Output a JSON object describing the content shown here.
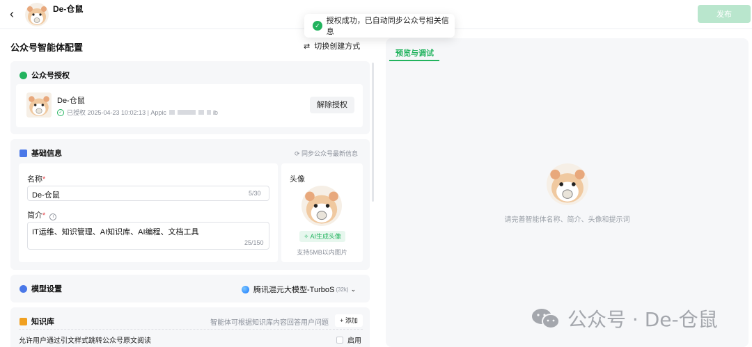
{
  "header": {
    "title": "De-仓鼠",
    "publish_label": "发布"
  },
  "toast": {
    "message": "授权成功，已自动同步公众号相关信息"
  },
  "left": {
    "section_title": "公众号智能体配置",
    "switch_label": "切换创建方式",
    "auth_card": {
      "title": "公众号授权",
      "account_name": "De-仓鼠",
      "status_text": "已授权 2025-04-23 10:02:13 | Appic",
      "masked_tail": "ib",
      "unbind_label": "解除授权"
    },
    "basic_card": {
      "title": "基础信息",
      "sync_label": "同步公众号最新信息",
      "name_label": "名称",
      "name_value": "De-仓鼠",
      "name_counter": "5/30",
      "intro_label": "简介",
      "intro_value": "IT运维、知识管理、AI知识库、AI编程、文档工具",
      "intro_counter": "25/150",
      "avatar_label": "头像",
      "ai_avatar_label": "AI生成头像",
      "avatar_hint": "支持5MB以内图片"
    },
    "model_card": {
      "title": "模型设置",
      "model_name": "腾讯混元大模型-TurboS",
      "model_ctx": "(32k)"
    },
    "kb_card": {
      "title": "知识库",
      "desc": "智能体可根据知识库内容回答用户问题",
      "add_label": "添加",
      "redirect_label": "允许用户通过引文样式跳转公众号原文阅读",
      "enable_label": "启用"
    }
  },
  "right": {
    "tab_label": "预览与调试",
    "empty_hint": "请完善智能体名称、简介、头像和提示词",
    "watermark": "公众号 · De-仓鼠"
  },
  "colors": {
    "accent": "#22b35e",
    "publish_disabled": "#b9e6cd",
    "panel_bg": "#f6f7f9",
    "required": "#e5484d"
  },
  "icons": [
    "back-arrow-icon",
    "check-circle-icon",
    "swap-icon",
    "wechat-icon",
    "calendar-icon",
    "sync-icon",
    "info-icon",
    "ai-magic-icon",
    "globe-icon",
    "chevron-down-icon",
    "book-icon",
    "plus-icon",
    "checkbox-icon"
  ]
}
